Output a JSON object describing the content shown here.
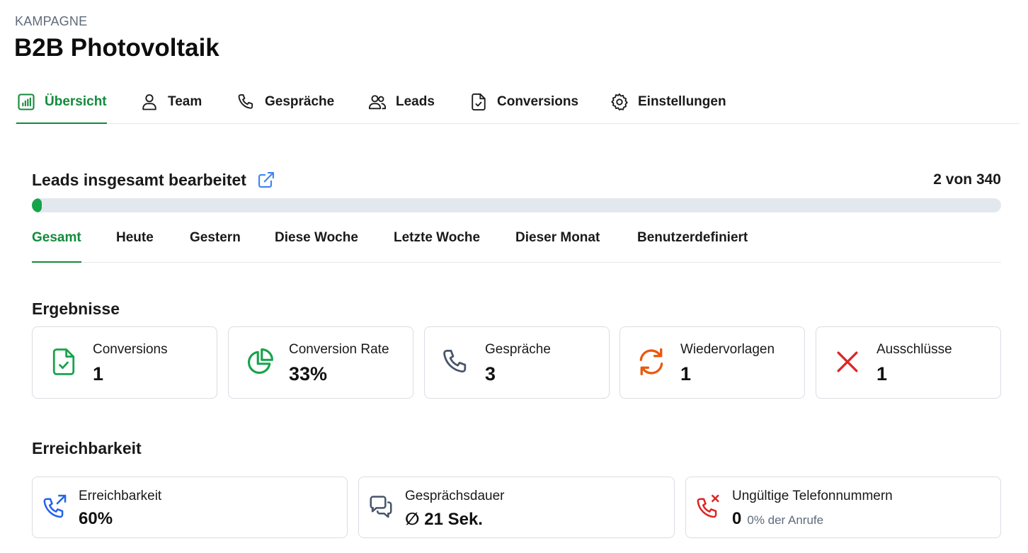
{
  "header": {
    "eyebrow": "KAMPAGNE",
    "title": "B2B Photovoltaik"
  },
  "tabs": [
    {
      "label": "Übersicht",
      "icon": "bar-chart-icon",
      "active": true
    },
    {
      "label": "Team",
      "icon": "user-icon",
      "active": false
    },
    {
      "label": "Gespräche",
      "icon": "phone-icon",
      "active": false
    },
    {
      "label": "Leads",
      "icon": "users-icon",
      "active": false
    },
    {
      "label": "Conversions",
      "icon": "file-check-icon",
      "active": false
    },
    {
      "label": "Einstellungen",
      "icon": "gear-icon",
      "active": false
    }
  ],
  "leads": {
    "title": "Leads insgesamt bearbeitet",
    "count_text": "2 von 340",
    "processed": 2,
    "total": 340
  },
  "periods": [
    {
      "label": "Gesamt",
      "active": true
    },
    {
      "label": "Heute",
      "active": false
    },
    {
      "label": "Gestern",
      "active": false
    },
    {
      "label": "Diese Woche",
      "active": false
    },
    {
      "label": "Letzte Woche",
      "active": false
    },
    {
      "label": "Dieser Monat",
      "active": false
    },
    {
      "label": "Benutzerdefiniert",
      "active": false
    }
  ],
  "results": {
    "title": "Ergebnisse",
    "cards": [
      {
        "label": "Conversions",
        "value": "1",
        "icon": "file-check-icon",
        "color": "#16a34a"
      },
      {
        "label": "Conversion Rate",
        "value": "33%",
        "icon": "pie-chart-icon",
        "color": "#16a34a"
      },
      {
        "label": "Gespräche",
        "value": "3",
        "icon": "phone-icon",
        "color": "#475569"
      },
      {
        "label": "Wiedervorlagen",
        "value": "1",
        "icon": "refresh-icon",
        "color": "#ea580c"
      },
      {
        "label": "Ausschlüsse",
        "value": "1",
        "icon": "x-icon",
        "color": "#dc2626"
      }
    ]
  },
  "reachability": {
    "title": "Erreichbarkeit",
    "cards": [
      {
        "label": "Erreichbarkeit",
        "value": "60%",
        "sub": "",
        "icon": "phone-outgoing-icon",
        "color": "#2563eb"
      },
      {
        "label": "Gesprächsdauer",
        "value": "∅ 21 Sek.",
        "sub": "",
        "icon": "chat-bubbles-icon",
        "color": "#475569"
      },
      {
        "label": "Ungültige Telefonnummern",
        "value": "0",
        "sub": "0% der Anrufe",
        "icon": "phone-x-icon",
        "color": "#dc2626"
      }
    ]
  },
  "colors": {
    "accent": "#138a3b",
    "progress": "#17a34a",
    "track": "#e3e8ef",
    "link_icon": "#3b82f6"
  }
}
